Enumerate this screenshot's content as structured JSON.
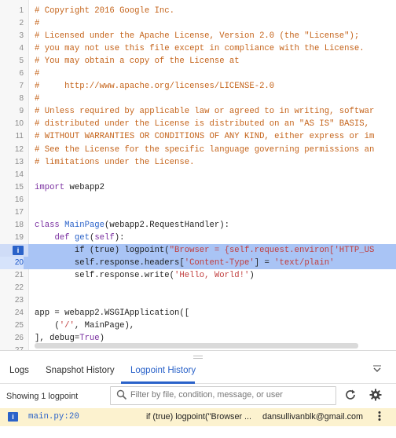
{
  "editor": {
    "lines": [
      {
        "n": "1",
        "code": [
          {
            "t": "# Copyright 2016 Google Inc.",
            "c": "com"
          }
        ]
      },
      {
        "n": "2",
        "code": [
          {
            "t": "#",
            "c": "com"
          }
        ]
      },
      {
        "n": "3",
        "code": [
          {
            "t": "# Licensed under the Apache License, Version 2.0 (the \"License\");",
            "c": "com"
          }
        ]
      },
      {
        "n": "4",
        "code": [
          {
            "t": "# you may not use this file except in compliance with the License.",
            "c": "com"
          }
        ]
      },
      {
        "n": "5",
        "code": [
          {
            "t": "# You may obtain a copy of the License at",
            "c": "com"
          }
        ]
      },
      {
        "n": "6",
        "code": [
          {
            "t": "#",
            "c": "com"
          }
        ]
      },
      {
        "n": "7",
        "code": [
          {
            "t": "#     http://www.apache.org/licenses/LICENSE-2.0",
            "c": "com"
          }
        ]
      },
      {
        "n": "8",
        "code": [
          {
            "t": "#",
            "c": "com"
          }
        ]
      },
      {
        "n": "9",
        "code": [
          {
            "t": "# Unless required by applicable law or agreed to in writing, softwar",
            "c": "com"
          }
        ]
      },
      {
        "n": "10",
        "code": [
          {
            "t": "# distributed under the License is distributed on an \"AS IS\" BASIS,",
            "c": "com"
          }
        ]
      },
      {
        "n": "11",
        "code": [
          {
            "t": "# WITHOUT WARRANTIES OR CONDITIONS OF ANY KIND, either express or im",
            "c": "com"
          }
        ]
      },
      {
        "n": "12",
        "code": [
          {
            "t": "# See the License for the specific language governing permissions an",
            "c": "com"
          }
        ]
      },
      {
        "n": "13",
        "code": [
          {
            "t": "# limitations under the License.",
            "c": "com"
          }
        ]
      },
      {
        "n": "14",
        "code": []
      },
      {
        "n": "15",
        "code": [
          {
            "t": "import",
            "c": "kw"
          },
          {
            "t": " webapp2",
            "c": ""
          }
        ]
      },
      {
        "n": "16",
        "code": []
      },
      {
        "n": "17",
        "code": []
      },
      {
        "n": "18",
        "code": [
          {
            "t": "class",
            "c": "kw"
          },
          {
            "t": " ",
            "c": ""
          },
          {
            "t": "MainPage",
            "c": "cls"
          },
          {
            "t": "(webapp2.RequestHandler):",
            "c": ""
          }
        ]
      },
      {
        "n": "19",
        "code": [
          {
            "t": "    ",
            "c": ""
          },
          {
            "t": "def",
            "c": "kw"
          },
          {
            "t": " ",
            "c": ""
          },
          {
            "t": "get",
            "c": "fn"
          },
          {
            "t": "(",
            "c": ""
          },
          {
            "t": "self",
            "c": "kw"
          },
          {
            "t": "):",
            "c": ""
          }
        ]
      },
      {
        "n": "",
        "marker": "i",
        "code": [
          {
            "t": "        if (true) logpoint(",
            "c": ""
          },
          {
            "t": "\"Browser = {self.request.environ['HTTP_US",
            "c": "str"
          }
        ]
      },
      {
        "n": "20",
        "active": true,
        "code": [
          {
            "t": "        self.response.headers[",
            "c": ""
          },
          {
            "t": "'Content-Type'",
            "c": "str"
          },
          {
            "t": "] = ",
            "c": ""
          },
          {
            "t": "'text/plain'",
            "c": "str"
          }
        ]
      },
      {
        "n": "21",
        "code": [
          {
            "t": "        self.response.write(",
            "c": ""
          },
          {
            "t": "'Hello, World!'",
            "c": "str"
          },
          {
            "t": ")",
            "c": ""
          }
        ]
      },
      {
        "n": "22",
        "code": []
      },
      {
        "n": "23",
        "code": []
      },
      {
        "n": "24",
        "code": [
          {
            "t": "app = webapp2.WSGIApplication([",
            "c": ""
          }
        ]
      },
      {
        "n": "25",
        "code": [
          {
            "t": "    (",
            "c": ""
          },
          {
            "t": "'/'",
            "c": "str"
          },
          {
            "t": ", MainPage),",
            "c": ""
          }
        ]
      },
      {
        "n": "26",
        "code": [
          {
            "t": "], debug=",
            "c": ""
          },
          {
            "t": "True",
            "c": "kw"
          },
          {
            "t": ")",
            "c": ""
          }
        ]
      },
      {
        "n": "27",
        "code": []
      }
    ]
  },
  "tabs": [
    {
      "label": "Logs"
    },
    {
      "label": "Snapshot History"
    },
    {
      "label": "Logpoint History"
    }
  ],
  "toolbar": {
    "showing": "Showing 1 logpoint",
    "filter_placeholder": "Filter by file, condition, message, or user"
  },
  "logpoint_row": {
    "badge": "i",
    "location": "main.py:20",
    "condition": "if (true) logpoint(\"Browser ...",
    "user": "dansullivanblk@gmail.com"
  },
  "colors": {
    "accent": "#2a62c9",
    "comment": "#c5641b",
    "keyword": "#7a2fa0",
    "string": "#c13e3e",
    "row_highlight": "#fcf2cf"
  }
}
